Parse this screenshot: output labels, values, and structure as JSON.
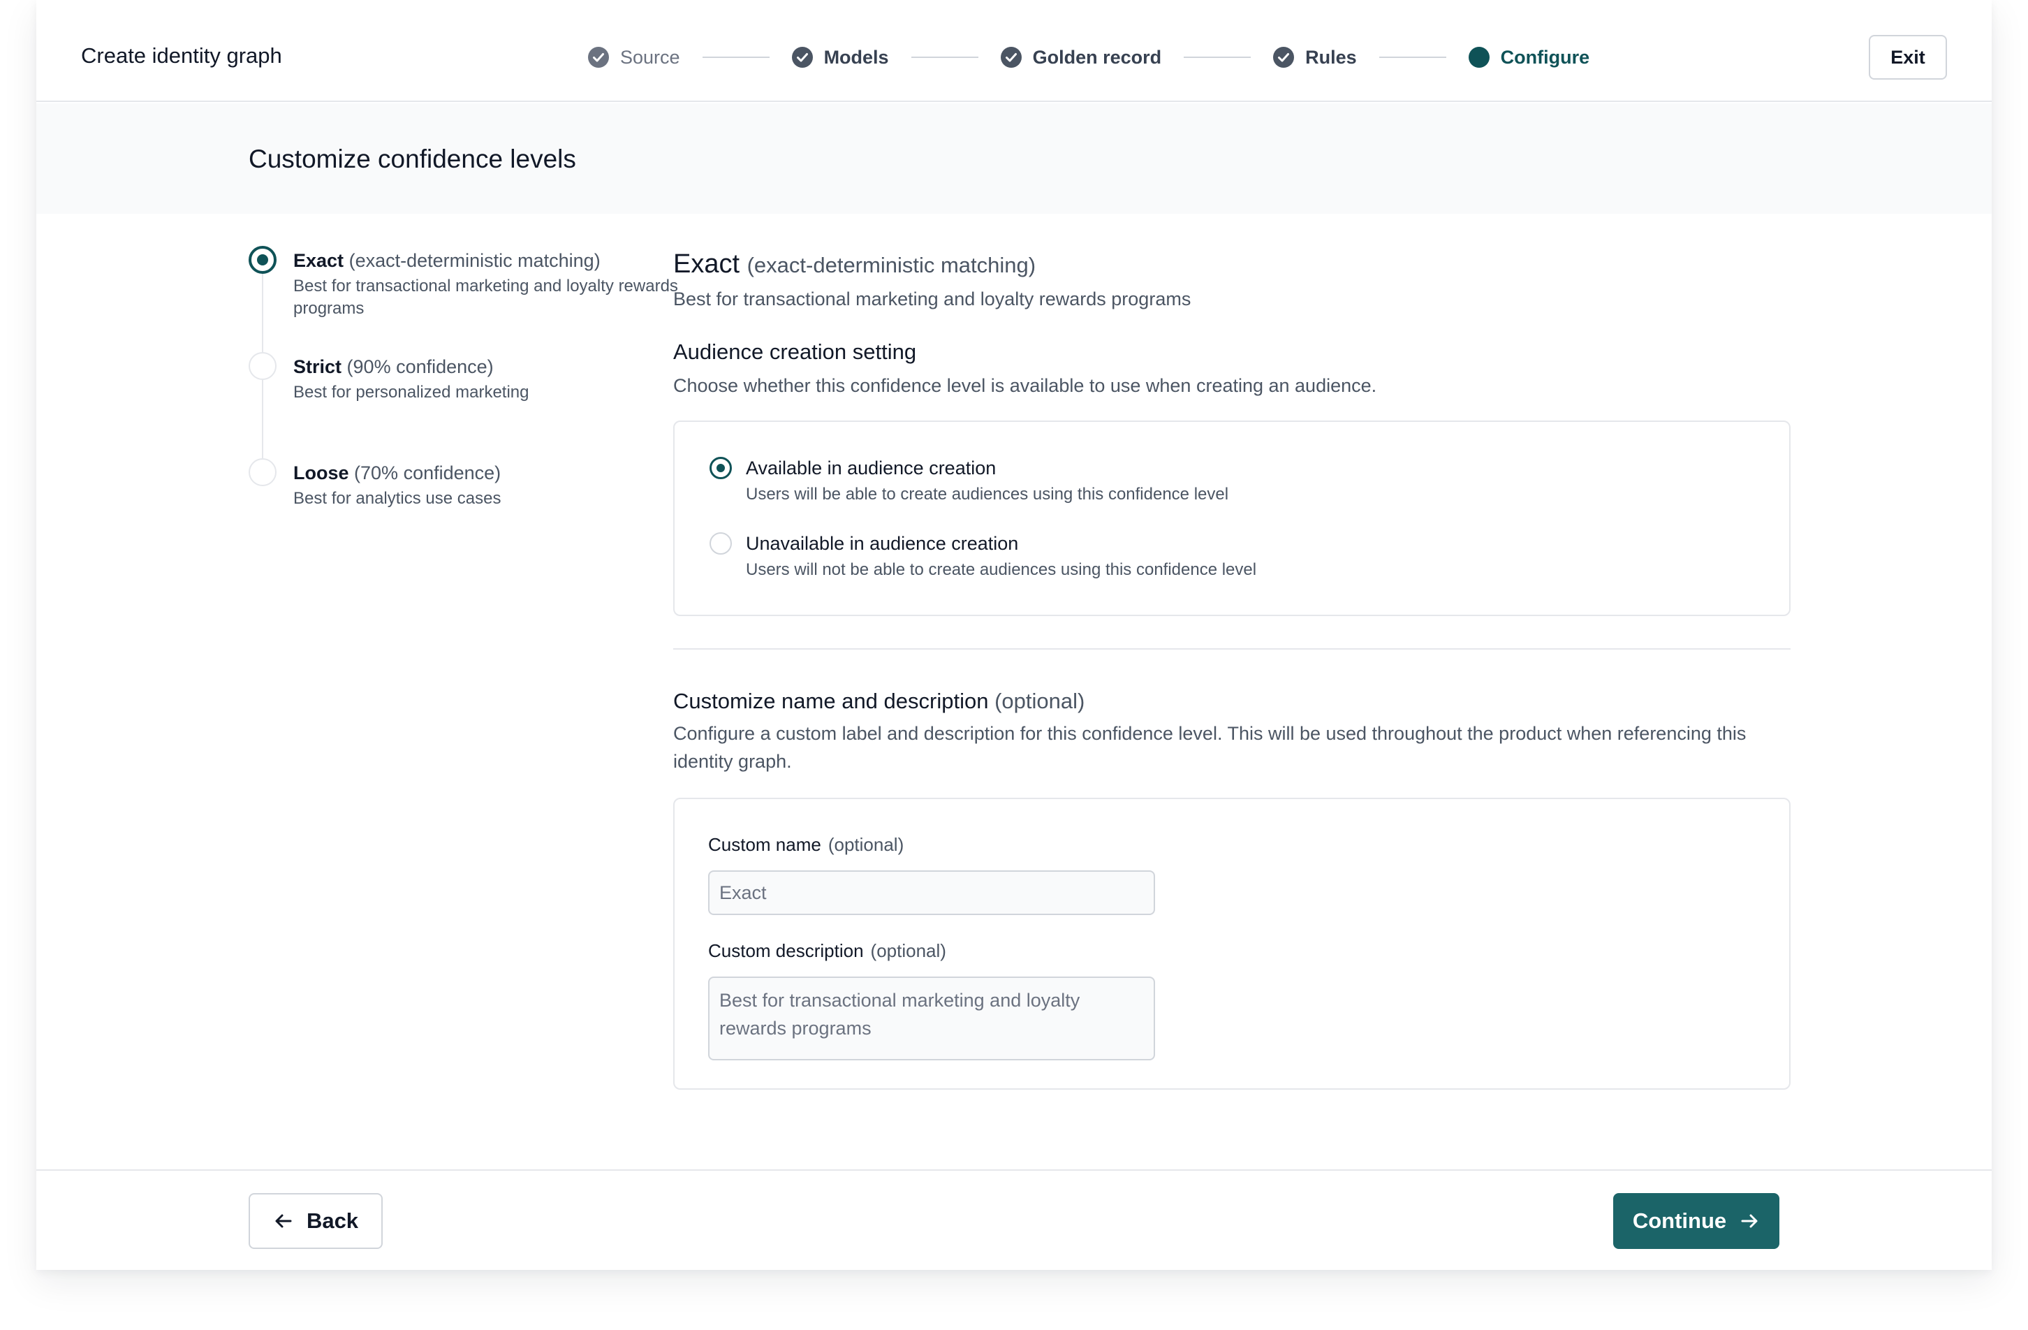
{
  "header": {
    "title": "Create identity graph",
    "exit_label": "Exit"
  },
  "stepper": {
    "steps": [
      {
        "label": "Source",
        "state": "complete-faint",
        "icon": "check-circle-icon"
      },
      {
        "label": "Models",
        "state": "complete",
        "icon": "check-circle-icon"
      },
      {
        "label": "Golden record",
        "state": "complete",
        "icon": "check-circle-icon"
      },
      {
        "label": "Rules",
        "state": "complete",
        "icon": "check-circle-icon"
      },
      {
        "label": "Configure",
        "state": "current",
        "icon": "filled-circle-icon"
      }
    ]
  },
  "page": {
    "title": "Customize confidence levels"
  },
  "levels": [
    {
      "name": "Exact",
      "qualifier": "(exact-deterministic matching)",
      "description": "Best for transactional marketing and loyalty rewards programs",
      "selected": true
    },
    {
      "name": "Strict",
      "qualifier": "(90% confidence)",
      "description": "Best for personalized marketing",
      "selected": false
    },
    {
      "name": "Loose",
      "qualifier": "(70% confidence)",
      "description": "Best for analytics use cases",
      "selected": false
    }
  ],
  "detail": {
    "name": "Exact",
    "qualifier": "(exact-deterministic matching)",
    "description": "Best for transactional marketing and loyalty rewards programs",
    "audience": {
      "title": "Audience creation setting",
      "description": "Choose whether this confidence level is available to use when creating an audience.",
      "options": [
        {
          "label": "Available in audience creation",
          "help": "Users will be able to create audiences using this confidence level",
          "checked": true
        },
        {
          "label": "Unavailable in audience creation",
          "help": "Users will not be able to create audiences using this confidence level",
          "checked": false
        }
      ]
    },
    "customize": {
      "title": "Customize name and description",
      "optional": "(optional)",
      "description": "Configure a custom label and description for this confidence level. This will be used throughout the product when referencing this identity graph.",
      "name_label": "Custom name",
      "name_optional": "(optional)",
      "name_placeholder": "Exact",
      "desc_label": "Custom description",
      "desc_optional": "(optional)",
      "desc_placeholder": "Best for transactional marketing and loyalty rewards programs"
    }
  },
  "footer": {
    "back_label": "Back",
    "continue_label": "Continue"
  },
  "colors": {
    "accent": "#0f5257",
    "primary_button": "#1b6468",
    "border": "#e5e7eb",
    "muted_text": "#4b5563"
  }
}
